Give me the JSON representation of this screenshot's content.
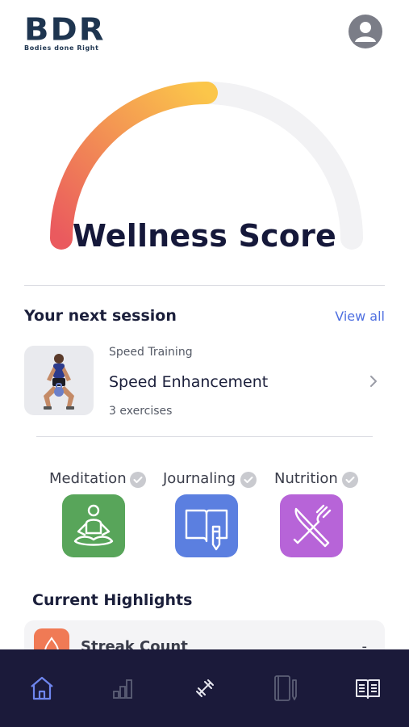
{
  "header": {
    "logo_text": "BDR",
    "logo_tagline": "Bodies done Right",
    "avatar_icon": "user-circle-icon"
  },
  "wellness": {
    "title": "Wellness Score",
    "score_fraction": 0.5,
    "gradient_start": "#ea5a5e",
    "gradient_end": "#fbc64a",
    "track_color": "#f2f2f4"
  },
  "next_session": {
    "heading": "Your next session",
    "view_all": "View all",
    "category": "Speed Training",
    "name": "Speed Enhancement",
    "exercises": "3 exercises",
    "chevron_icon": "chevron-right-icon"
  },
  "habits": [
    {
      "label": "Meditation",
      "icon": "meditation-icon",
      "color": "#58a55a"
    },
    {
      "label": "Journaling",
      "icon": "journal-icon",
      "color": "#5b7fe0"
    },
    {
      "label": "Nutrition",
      "icon": "fork-knife-icon",
      "color": "#b764d8"
    }
  ],
  "highlights": {
    "heading": "Current Highlights",
    "card_label": "Streak Count",
    "card_value": "-"
  },
  "tabbar": {
    "accent": "#6f86ee",
    "items": [
      {
        "icon": "home-icon",
        "active": true
      },
      {
        "icon": "stats-icon",
        "active": false
      },
      {
        "icon": "dumbbell-icon",
        "active": false
      },
      {
        "icon": "notebook-icon",
        "active": false
      },
      {
        "icon": "open-book-icon",
        "active": false
      }
    ]
  }
}
